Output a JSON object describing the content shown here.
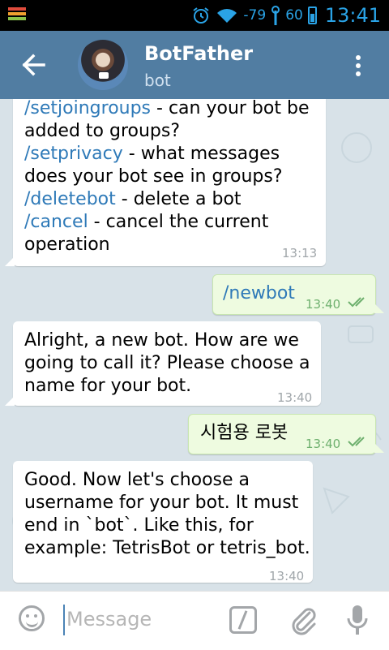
{
  "status_bar": {
    "signal": "-79",
    "battery": "60",
    "time": "13:41"
  },
  "header": {
    "title": "BotFather",
    "subtitle": "bot"
  },
  "messages": [
    {
      "direction": "in",
      "lines": [
        {
          "cmd": "/setjoingroups",
          "rest": " - can your bot be"
        },
        {
          "cmd": "",
          "rest": "added to groups?"
        },
        {
          "cmd": "/setprivacy",
          "rest": " - what messages"
        },
        {
          "cmd": "",
          "rest": "does your bot see in groups?"
        },
        {
          "cmd": "/deletebot",
          "rest": " - delete a bot"
        },
        {
          "cmd": "/cancel",
          "rest": " - cancel the current"
        },
        {
          "cmd": "",
          "rest": "operation"
        }
      ],
      "time": "13:13"
    },
    {
      "direction": "out",
      "text": "/newbot",
      "time": "13:40"
    },
    {
      "direction": "in",
      "text_lines": [
        "Alright, a new bot. How are we",
        "going to call it? Please choose a",
        "name for your bot."
      ],
      "time": "13:40"
    },
    {
      "direction": "out",
      "text": "시험용 로봇",
      "time": "13:40"
    },
    {
      "direction": "in",
      "text_lines": [
        "Good. Now let's choose a",
        "username for your bot. It must",
        "end in `bot`. Like this, for",
        "example: TetrisBot or tetris_bot."
      ],
      "time": "13:40"
    }
  ],
  "input": {
    "placeholder": "Message"
  },
  "icons": [
    "back-arrow-icon",
    "more-vert-icon",
    "emoji-icon",
    "bot-command-icon",
    "attach-icon",
    "mic-icon",
    "double-check-icon",
    "alarm-icon",
    "wifi-icon"
  ],
  "colors": {
    "header": "#517da2",
    "link": "#2f7ab8",
    "out_bubble": "#eefbe0",
    "check": "#6eb06e"
  }
}
